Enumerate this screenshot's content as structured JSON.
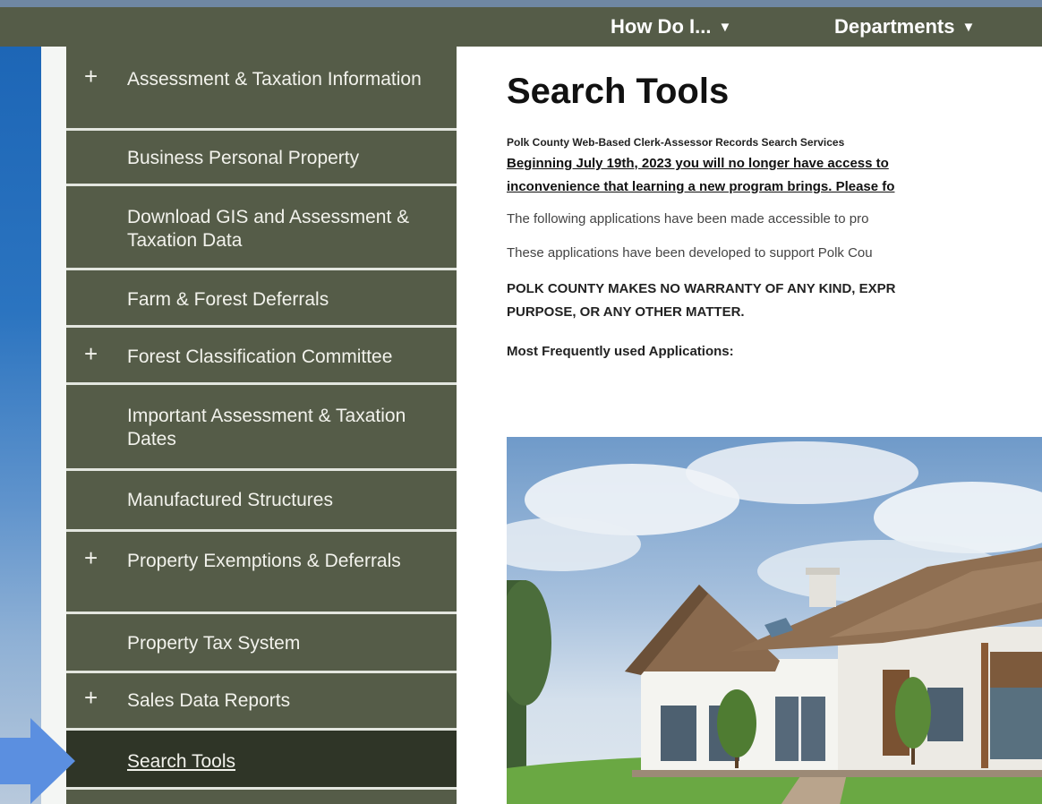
{
  "topnav": {
    "how_do_i": "How Do I...",
    "departments": "Departments"
  },
  "sidebar": {
    "items": [
      {
        "label": "Assessment & Taxation Information",
        "expandable": true
      },
      {
        "label": "Business Personal Property",
        "expandable": false
      },
      {
        "label": "Download GIS and Assessment & Taxation Data",
        "expandable": false
      },
      {
        "label": "Farm & Forest Deferrals",
        "expandable": false
      },
      {
        "label": "Forest Classification Committee",
        "expandable": true
      },
      {
        "label": "Important Assessment & Taxation Dates",
        "expandable": false
      },
      {
        "label": "Manufactured Structures",
        "expandable": false
      },
      {
        "label": "Property Exemptions & Deferrals",
        "expandable": true
      },
      {
        "label": "Property Tax System",
        "expandable": false
      },
      {
        "label": "Sales Data Reports",
        "expandable": true
      },
      {
        "label": "Search Tools",
        "expandable": false,
        "active": true
      }
    ],
    "plus_glyph": "+"
  },
  "main": {
    "title": "Search Tools",
    "subtitle": "Polk County Web-Based Clerk-Assessor Records Search Services",
    "notice_line1": "Beginning July 19th, 2023 you will no longer have access to",
    "notice_line2": "inconvenience that learning a new program brings. Please fo",
    "para1": "The following applications have been made accessible to pro",
    "para2": "These applications have been developed to support Polk Cou",
    "warning_line1": "POLK COUNTY MAKES NO WARRANTY OF ANY KIND, EXPR",
    "warning_line2": "PURPOSE, OR ANY OTHER MATTER.",
    "frequent_heading": "Most Frequently used Applications:"
  },
  "colors": {
    "nav_bg": "#555c48",
    "sidebar_bg": "#555c48",
    "active_bg": "#2f3527",
    "arrow": "#5b8fe0"
  },
  "icons": {
    "caret": "caret-down-icon",
    "plus": "plus-icon",
    "pointer": "arrow-pointer-icon"
  }
}
